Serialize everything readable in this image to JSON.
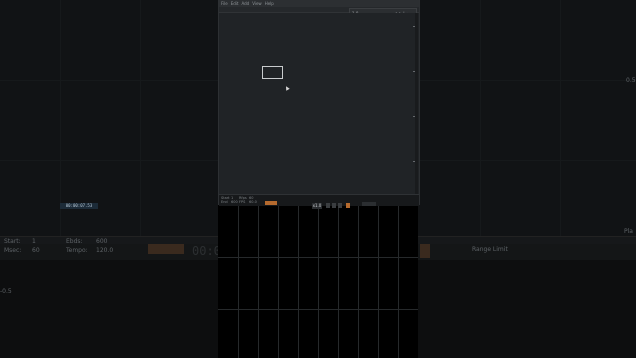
{
  "menu": [
    "File",
    "Edit",
    "Add",
    "View",
    "Help"
  ],
  "panel": {
    "value": "1.0",
    "controls": "< >  |  ◦"
  },
  "transport": {
    "time": "00:00:07.53",
    "fps": "x1.0",
    "info_left": [
      "Start",
      "End",
      "Rfps",
      "FPS"
    ],
    "info_values": [
      "1",
      "600",
      "60",
      "60.0"
    ]
  },
  "background": {
    "info_labels": [
      "Start:",
      "Ebds:",
      "Tempo:",
      "Msec:"
    ],
    "info_values": [
      "1",
      "600",
      "120.0",
      "60"
    ],
    "timecode": "00:0",
    "range_label": "Range Limit",
    "right_axis": [
      "0.5",
      "Pla"
    ],
    "left_axis": [
      "-0.5"
    ]
  }
}
